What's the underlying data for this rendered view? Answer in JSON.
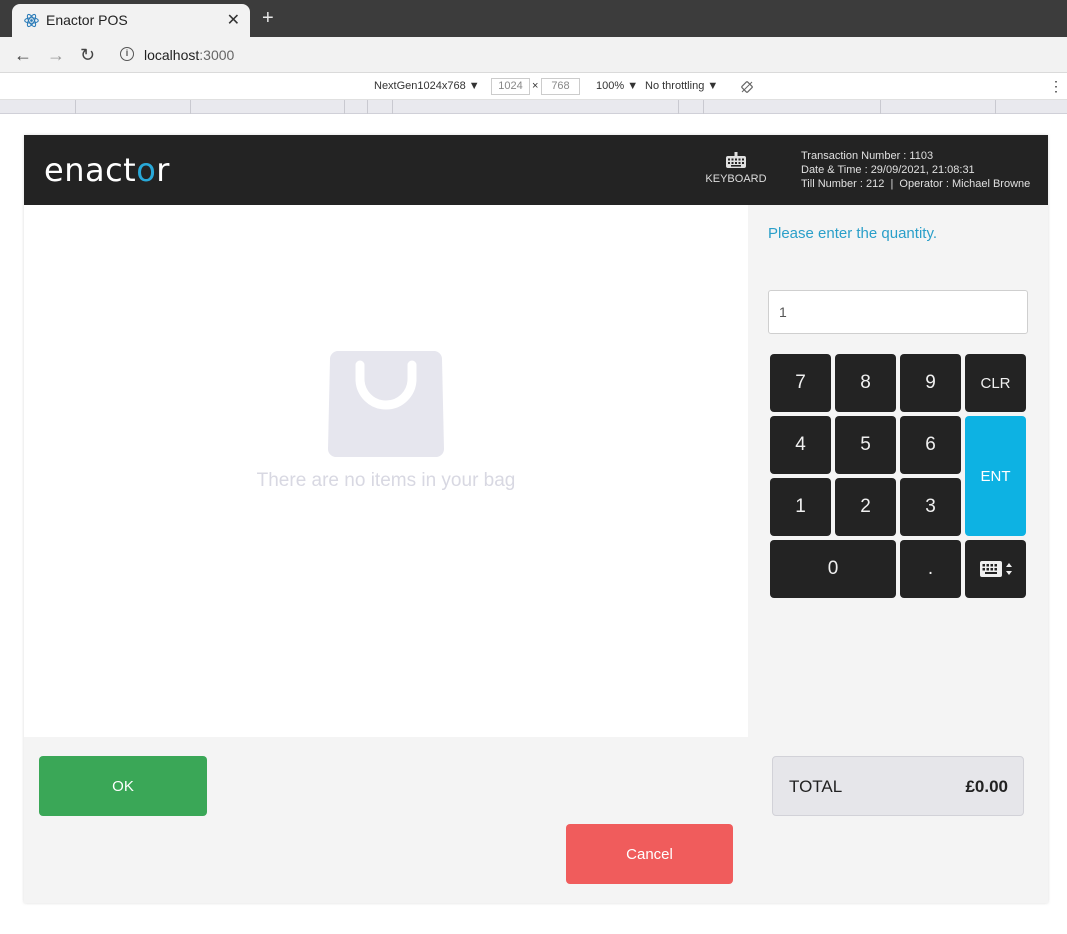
{
  "browser": {
    "tab_title": "Enactor POS",
    "tab_close": "✕",
    "new_tab": "+",
    "back": "←",
    "forward": "→",
    "reload": "↻",
    "url_host": "localhost",
    "url_port": ":3000",
    "devtools": {
      "device": "NextGen1024x768 ▼",
      "width": "1024",
      "x": "×",
      "height": "768",
      "zoom": "100% ▼",
      "throttle": "No throttling ▼",
      "menu": "⋮"
    }
  },
  "header": {
    "logo_pre": "enact",
    "logo_o": "o",
    "logo_post": "r",
    "keyboard_label": "KEYBOARD",
    "transaction": "Transaction Number : 1103",
    "datetime": "Date & Time : 29/09/2021, 21:08:31",
    "till": "Till Number : 212  |  Operator : Michael Browne"
  },
  "basket": {
    "empty_message": "There are no items in your bag"
  },
  "entry": {
    "prompt": "Please enter the quantity.",
    "value": "1"
  },
  "keypad": {
    "k7": "7",
    "k8": "8",
    "k9": "9",
    "clr": "CLR",
    "k4": "4",
    "k5": "5",
    "k6": "6",
    "ent": "ENT",
    "k1": "1",
    "k2": "2",
    "k3": "3",
    "k0": "0",
    "dot": "."
  },
  "actions": {
    "ok": "OK",
    "cancel": "Cancel"
  },
  "total": {
    "label": "TOTAL",
    "value": "£0.00"
  },
  "colors": {
    "header_bg": "#232323",
    "accent": "#2a9fc9",
    "ent": "#0db2e3",
    "ok": "#3aa757",
    "cancel": "#f05c5c"
  }
}
